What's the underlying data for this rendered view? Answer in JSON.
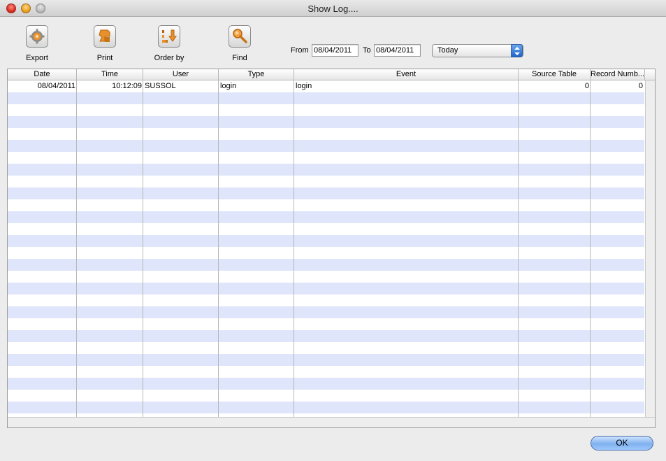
{
  "window": {
    "title": "Show Log...."
  },
  "toolbar": {
    "export_label": "Export",
    "print_label": "Print",
    "order_by_label": "Order by",
    "find_label": "Find"
  },
  "filter": {
    "from_label": "From",
    "from_value": "08/04/2011",
    "to_label": "To",
    "to_value": "08/04/2011",
    "range_selected": "Today"
  },
  "table": {
    "columns": [
      "Date",
      "Time",
      "User",
      "Type",
      "Event",
      "Source Table",
      "Record Numb..."
    ],
    "rows": [
      {
        "date": "08/04/2011",
        "time": "10:12:09",
        "user": "SUSSOL",
        "type": "login",
        "event": "login",
        "source_table": "0",
        "record_number": "0"
      }
    ]
  },
  "dialog": {
    "ok_label": "OK"
  },
  "colors": {
    "row_alt": "#dfe5fa",
    "ok_button": "#7fb1ee"
  }
}
